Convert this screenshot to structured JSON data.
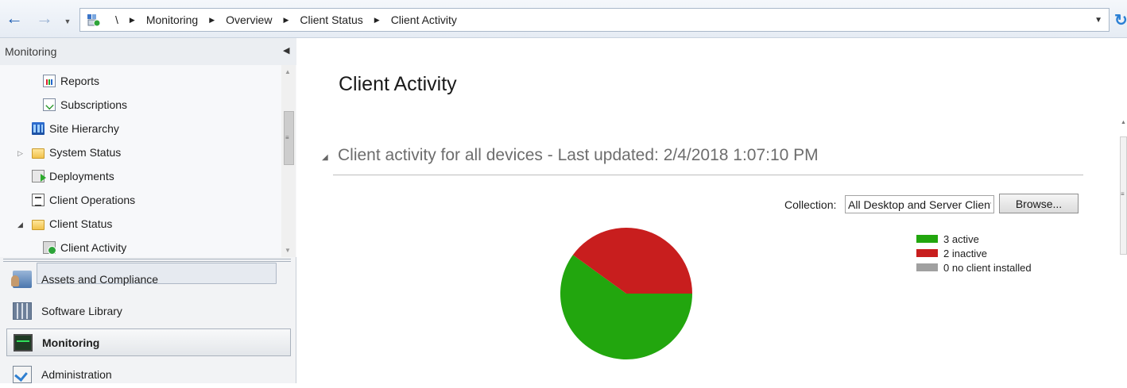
{
  "breadcrumb": {
    "root": "\\",
    "items": [
      "Monitoring",
      "Overview",
      "Client Status",
      "Client Activity"
    ]
  },
  "nav": {
    "title": "Monitoring",
    "tree": [
      {
        "label": "Reports",
        "icon": "report-icon"
      },
      {
        "label": "Subscriptions",
        "icon": "subscription-icon"
      },
      {
        "label": "Site Hierarchy",
        "icon": "site-hierarchy-icon"
      },
      {
        "label": "System Status",
        "icon": "folder-icon",
        "expander": "collapsed"
      },
      {
        "label": "Deployments",
        "icon": "deployment-icon"
      },
      {
        "label": "Client Operations",
        "icon": "client-operations-icon"
      },
      {
        "label": "Client Status",
        "icon": "folder-icon",
        "expander": "expanded"
      },
      {
        "label": "Client Activity",
        "icon": "client-activity-icon",
        "selected": true
      }
    ],
    "workspaces": [
      {
        "label": "Assets and Compliance",
        "icon": "assets-icon"
      },
      {
        "label": "Software Library",
        "icon": "software-library-icon"
      },
      {
        "label": "Monitoring",
        "icon": "monitoring-icon",
        "active": true
      },
      {
        "label": "Administration",
        "icon": "administration-icon"
      }
    ]
  },
  "main": {
    "title": "Client Activity",
    "section_title": "Client activity for all devices - Last updated: 2/4/2018 1:07:10 PM",
    "collection_label": "Collection:",
    "collection_value": "All Desktop and Server Clients",
    "browse_label": "Browse..."
  },
  "chart_data": {
    "type": "pie",
    "slices": [
      {
        "label": "3 active",
        "value": 3,
        "color": "#22a60e"
      },
      {
        "label": "2 inactive",
        "value": 2,
        "color": "#c81e1e"
      },
      {
        "label": "0 no client installed",
        "value": 0,
        "color": "#a0a0a0"
      }
    ],
    "legend_position": "right"
  }
}
